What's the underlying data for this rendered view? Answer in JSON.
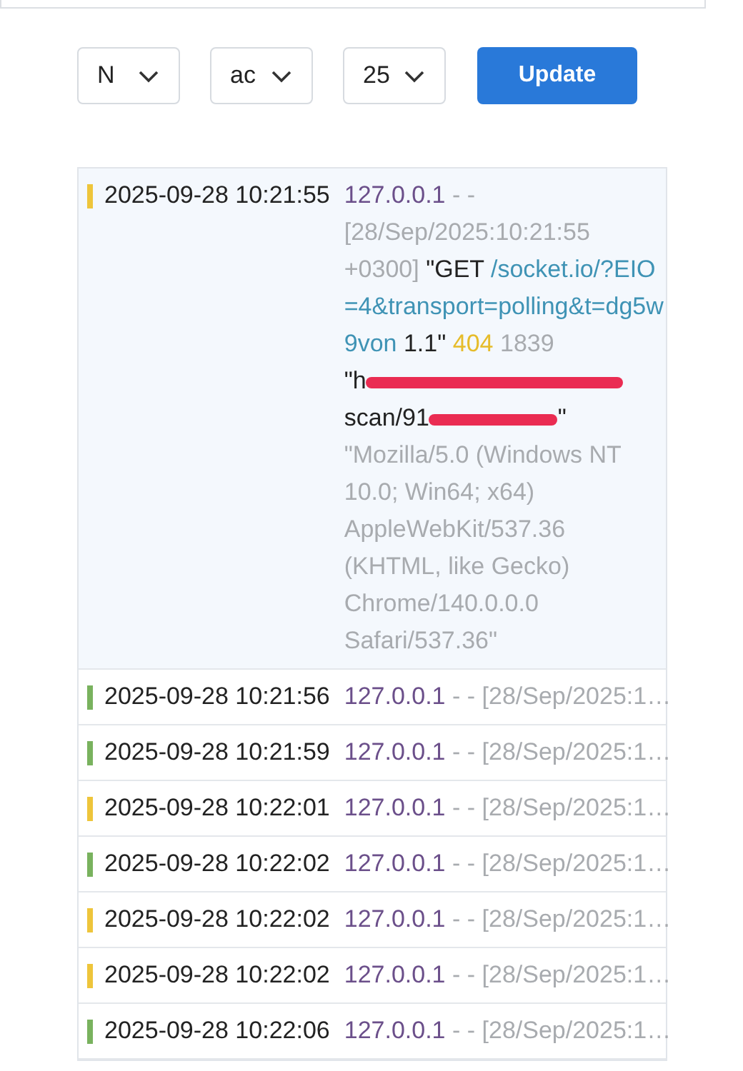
{
  "filters": [
    {
      "value": "N"
    },
    {
      "value": "ac"
    },
    {
      "value": "25"
    }
  ],
  "update_button": "Update",
  "log_entries": [
    {
      "time": "2025-09-28 10:21:55",
      "color": "#eec53b",
      "expanded": true,
      "ip": "127.0.0.1",
      "dashes": "- -",
      "timestamp": "[28/Sep/2025:10:21:55 +0300]",
      "method": "\"GET",
      "path": "/socket.io/?EIO=4&transport=polling&t=dg5w9von",
      "protocol": "1.1\"",
      "status": "404",
      "size": "1839",
      "referer_start": "\"h",
      "referer_middle": "scan/91",
      "referer_end": "\"",
      "user_agent": "\"Mozilla/5.0 (Windows NT 10.0; Win64; x64) AppleWebKit/537.36 (KHTML, like Gecko) Chrome/140.0.0.0 Safari/537.36\""
    },
    {
      "time": "2025-09-28 10:21:56",
      "color": "#79b25e",
      "expanded": false,
      "ip": "127.0.0.1",
      "rest": "- - [28/Sep/2025:1…"
    },
    {
      "time": "2025-09-28 10:21:59",
      "color": "#79b25e",
      "expanded": false,
      "ip": "127.0.0.1",
      "rest": "- - [28/Sep/2025:1…"
    },
    {
      "time": "2025-09-28 10:22:01",
      "color": "#eec53b",
      "expanded": false,
      "ip": "127.0.0.1",
      "rest": "- - [28/Sep/2025:1…"
    },
    {
      "time": "2025-09-28 10:22:02",
      "color": "#79b25e",
      "expanded": false,
      "ip": "127.0.0.1",
      "rest": "- - [28/Sep/2025:1…"
    },
    {
      "time": "2025-09-28 10:22:02",
      "color": "#eec53b",
      "expanded": false,
      "ip": "127.0.0.1",
      "rest": "- - [28/Sep/2025:1…"
    },
    {
      "time": "2025-09-28 10:22:02",
      "color": "#eec53b",
      "expanded": false,
      "ip": "127.0.0.1",
      "rest": "- - [28/Sep/2025:1…"
    },
    {
      "time": "2025-09-28 10:22:06",
      "color": "#79b25e",
      "expanded": false,
      "ip": "127.0.0.1",
      "rest": "- - [28/Sep/2025:1…"
    }
  ]
}
